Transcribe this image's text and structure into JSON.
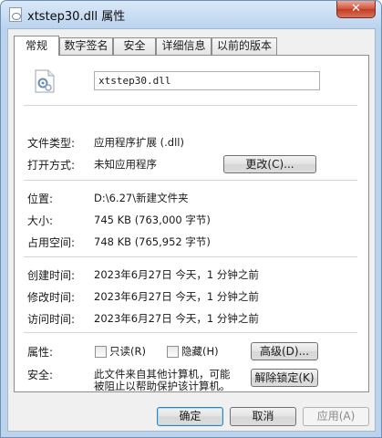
{
  "window": {
    "title": "xtstep30.dll 属性",
    "close_glyph": "✕"
  },
  "tabs": [
    {
      "label": "常规",
      "active": true
    },
    {
      "label": "数字签名",
      "active": false
    },
    {
      "label": "安全",
      "active": false
    },
    {
      "label": "详细信息",
      "active": false
    },
    {
      "label": "以前的版本",
      "active": false
    }
  ],
  "general": {
    "filename": "xtstep30.dll",
    "file_type_label": "文件类型:",
    "file_type_value": "应用程序扩展 (.dll)",
    "opens_with_label": "打开方式:",
    "opens_with_value": "未知应用程序",
    "change_button": "更改(C)...",
    "location_label": "位置:",
    "location_value": "D:\\6.27\\新建文件夹",
    "size_label": "大小:",
    "size_value": "745 KB (763,000 字节)",
    "size_on_disk_label": "占用空间:",
    "size_on_disk_value": "748 KB (765,952 字节)",
    "created_label": "创建时间:",
    "created_value": "2023年6月27日 今天，1 分钟之前",
    "modified_label": "修改时间:",
    "modified_value": "2023年6月27日 今天，1 分钟之前",
    "accessed_label": "访问时间:",
    "accessed_value": "2023年6月27日 今天，1 分钟之前",
    "attributes_label": "属性:",
    "readonly_label": "只读(R)",
    "hidden_label": "隐藏(H)",
    "advanced_button": "高级(D)...",
    "security_label": "安全:",
    "security_text_line1": "此文件来自其他计算机，可能",
    "security_text_line2": "被阻止以帮助保护该计算机。",
    "unblock_button": "解除锁定(K)"
  },
  "footer": {
    "ok": "确定",
    "cancel": "取消",
    "apply": "应用(A)"
  },
  "icons": {
    "file": "dll-file-icon",
    "title": "dll-title-icon",
    "close": "close-icon"
  }
}
